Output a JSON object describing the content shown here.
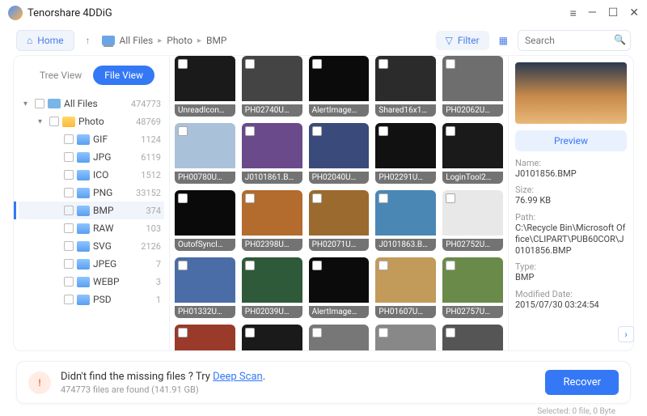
{
  "title": "Tenorshare 4DDiG",
  "toolbar": {
    "home": "Home",
    "breadcrumb": [
      "All Files",
      "Photo",
      "BMP"
    ],
    "filter": "Filter",
    "search_placeholder": "Search"
  },
  "sidebar": {
    "tree_view_label": "Tree View",
    "file_view_label": "File View",
    "root": {
      "label": "All Files",
      "count": "474773"
    },
    "photo": {
      "label": "Photo",
      "count": "48769"
    },
    "types": [
      {
        "label": "GIF",
        "count": "1124"
      },
      {
        "label": "JPG",
        "count": "6119"
      },
      {
        "label": "ICO",
        "count": "1512"
      },
      {
        "label": "PNG",
        "count": "33152"
      },
      {
        "label": "BMP",
        "count": "374"
      },
      {
        "label": "RAW",
        "count": "103"
      },
      {
        "label": "SVG",
        "count": "2126"
      },
      {
        "label": "JPEG",
        "count": "7"
      },
      {
        "label": "WEBP",
        "count": "3"
      },
      {
        "label": "PSD",
        "count": "1"
      }
    ]
  },
  "grid": [
    {
      "name": "UnreadIcon…",
      "bg": "#1a1a1a"
    },
    {
      "name": "PH02740U…",
      "bg": "#444"
    },
    {
      "name": "AlertImage…",
      "bg": "#0b0b0b"
    },
    {
      "name": "Shared16x1…",
      "bg": "#2b2b2b"
    },
    {
      "name": "PH02062U…",
      "bg": "#6e6e6e"
    },
    {
      "name": "PH00780U…",
      "bg": "#a9c2d9"
    },
    {
      "name": "J0101861.B…",
      "bg": "#6b4a8c"
    },
    {
      "name": "PH02040U…",
      "bg": "#3a4a7a"
    },
    {
      "name": "PH02291U…",
      "bg": "#111"
    },
    {
      "name": "LoginTool2…",
      "bg": "#1a1a1a"
    },
    {
      "name": "OutofSyncI…",
      "bg": "#0a0a0a"
    },
    {
      "name": "PH02398U…",
      "bg": "#b36b2e"
    },
    {
      "name": "PH02071U…",
      "bg": "#9a6a2e"
    },
    {
      "name": "J0101863.B…",
      "bg": "#4a87b5"
    },
    {
      "name": "PH02752U…",
      "bg": "#e8e8e8"
    },
    {
      "name": "PH01332U…",
      "bg": "#4a6da8"
    },
    {
      "name": "PH02039U…",
      "bg": "#2e5a3a"
    },
    {
      "name": "AlertImage…",
      "bg": "#0b0b0b"
    },
    {
      "name": "PH01607U…",
      "bg": "#c29a5a"
    },
    {
      "name": "PH02757U…",
      "bg": "#6a8a4a"
    },
    {
      "name": "",
      "bg": "#9a3a2a"
    },
    {
      "name": "",
      "bg": "#1a1a1a"
    },
    {
      "name": "",
      "bg": "#777"
    },
    {
      "name": "",
      "bg": "#888"
    },
    {
      "name": "",
      "bg": "#555"
    }
  ],
  "preview": {
    "btn": "Preview",
    "name_label": "Name:",
    "name": "J0101856.BMP",
    "size_label": "Size:",
    "size": "76.99 KB",
    "path_label": "Path:",
    "path": "C:\\Recycle Bin\\Microsoft Office\\CLIPART\\PUB60COR\\J0101856.BMP",
    "type_label": "Type:",
    "type": "BMP",
    "mdate_label": "Modified Date:",
    "mdate": "2015/07/30 03:24:54"
  },
  "footer": {
    "question": "Didn't find the missing files ? Try ",
    "link": "Deep Scan",
    "period": ".",
    "sub": "474773 files are found (141.91 GB)",
    "recover": "Recover",
    "selected": "Selected: 0 file, 0 Byte"
  }
}
